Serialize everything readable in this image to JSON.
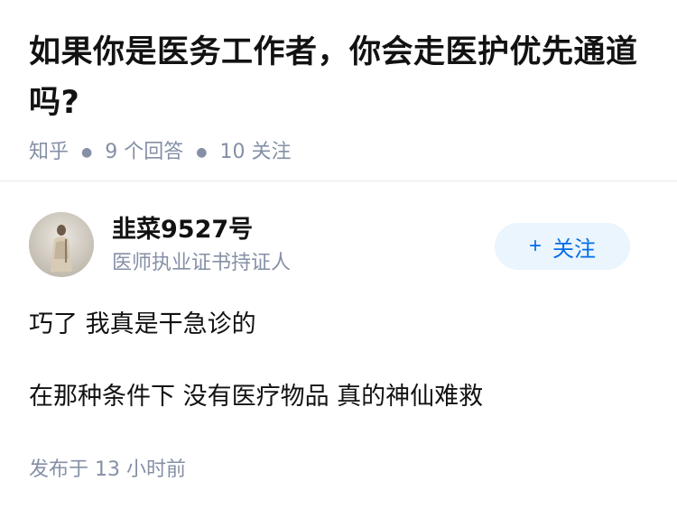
{
  "question": {
    "title": "如果你是医务工作者，你会走医护优先通道吗?",
    "source": "知乎",
    "answer_count": "9 个回答",
    "follow_count": "10 关注"
  },
  "author": {
    "name": "韭菜9527号",
    "badge": "医师执业证书持证人",
    "follow_label": "关注",
    "follow_icon": "plus-icon"
  },
  "answer": {
    "paragraphs": [
      "巧了 我真是干急诊的",
      "在那种条件下 没有医疗物品 真的神仙难救"
    ],
    "time": "发布于 13 小时前"
  },
  "colors": {
    "accent": "#056de8",
    "follow_bg": "#ebf5fd",
    "meta": "#8590a6",
    "text": "#121212"
  }
}
